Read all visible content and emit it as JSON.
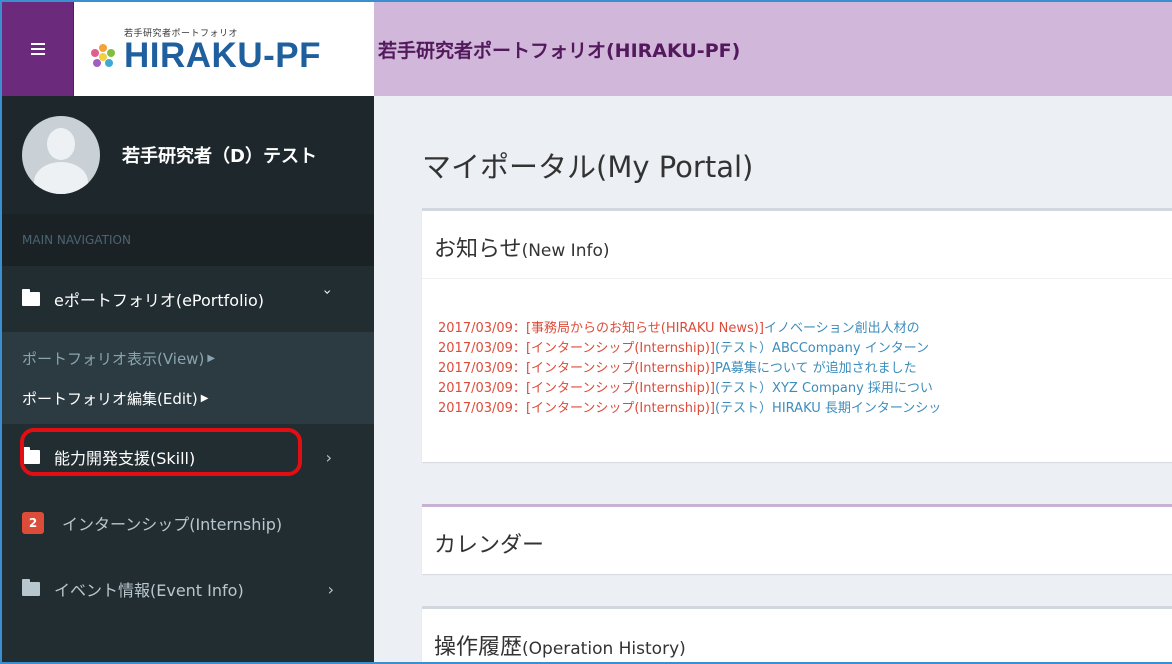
{
  "header": {
    "logo_small": "若手研究者ポートフォリオ",
    "logo_main": "HIRAKU-PF",
    "app_title": "若手研究者ポートフォリオ(HIRAKU-PF)"
  },
  "sidebar": {
    "user_name": "若手研究者（D）テスト",
    "nav_header": "MAIN NAVIGATION",
    "items": [
      {
        "label": "eポートフォリオ(ePortfolio)"
      },
      {
        "label": "能力開発支援(Skill)"
      },
      {
        "label": "インターンシップ(Internship)",
        "badge": "2"
      },
      {
        "label": "イベント情報(Event Info)"
      }
    ],
    "submenu": [
      {
        "label": "ポートフォリオ表示(View)"
      },
      {
        "label": "ポートフォリオ編集(Edit)"
      }
    ]
  },
  "main": {
    "page_title": "マイポータル(My Portal)",
    "news": {
      "title": "お知らせ",
      "title_en": "(New Info)",
      "items": [
        {
          "date": "2017/03/09：",
          "category": "[事務局からのお知らせ(HIRAKU News)]",
          "text": "イノベーション創出人材の"
        },
        {
          "date": "2017/03/09：",
          "category": "[インターンシップ(Internship)]",
          "text": "(テスト）ABCCompany インターン"
        },
        {
          "date": "2017/03/09：",
          "category": "[インターンシップ(Internship)]",
          "text": "PA募集について が追加されました"
        },
        {
          "date": "2017/03/09：",
          "category": "[インターンシップ(Internship)]",
          "text": "(テスト）XYZ Company 採用につい"
        },
        {
          "date": "2017/03/09：",
          "category": "[インターンシップ(Internship)]",
          "text": "(テスト）HIRAKU 長期インターンシッ"
        }
      ]
    },
    "calendar": {
      "title": "カレンダー"
    },
    "history": {
      "title": "操作履歴",
      "title_en": "(Operation History)"
    }
  },
  "colors": {
    "menu_purple": "#6b2a7c",
    "header_lilac": "#d1b7d9",
    "sidebar_dark": "#222d32",
    "highlight_red": "#e30d14",
    "news_red": "#dd4b39",
    "link_blue": "#3c8dbc"
  }
}
